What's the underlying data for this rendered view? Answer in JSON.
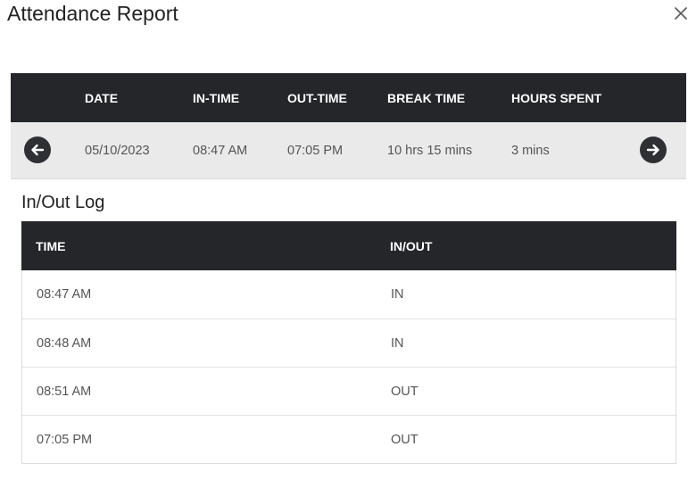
{
  "dialog": {
    "title": "Attendance Report",
    "close_icon": "close-icon"
  },
  "summary": {
    "columns": [
      "DATE",
      "IN-TIME",
      "OUT-TIME",
      "BREAK TIME",
      "HOURS SPENT"
    ],
    "row": {
      "date": "05/10/2023",
      "in_time": "08:47 AM",
      "out_time": "07:05 PM",
      "break_time": "10 hrs 15 mins",
      "hours_spent": "3 mins"
    },
    "prev_icon": "arrow-left-circle-icon",
    "next_icon": "arrow-right-circle-icon"
  },
  "log": {
    "title": "In/Out Log",
    "columns": [
      "TIME",
      "IN/OUT"
    ],
    "rows": [
      {
        "time": "08:47 AM",
        "io": "IN"
      },
      {
        "time": "08:48 AM",
        "io": "IN"
      },
      {
        "time": "08:51 AM",
        "io": "OUT"
      },
      {
        "time": "07:05 PM",
        "io": "OUT"
      }
    ]
  },
  "colors": {
    "header_bg": "#24262a",
    "summary_row_bg": "#eaeaea",
    "nav_button_bg": "#2f3033"
  }
}
